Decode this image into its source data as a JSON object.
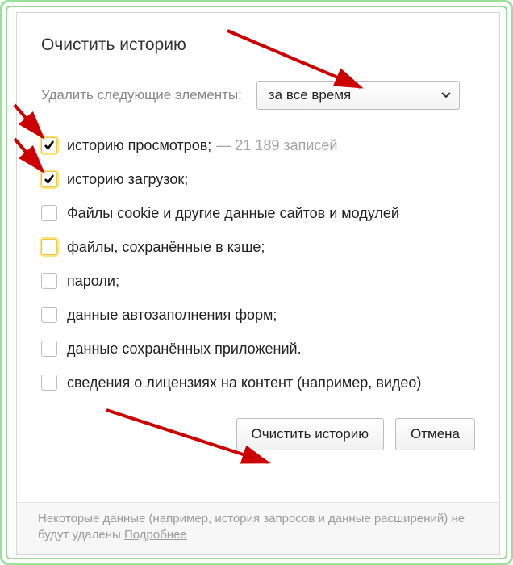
{
  "dialog": {
    "title": "Очистить историю",
    "period_label": "Удалить следующие элементы:",
    "period_value": "за все время"
  },
  "options": [
    {
      "label": "историю просмотров;",
      "checked": true,
      "highlight": true,
      "count": "21 189 записей"
    },
    {
      "label": "историю загрузок;",
      "checked": true,
      "highlight": true,
      "count": null
    },
    {
      "label": "Файлы cookie и другие данные сайтов и модулей",
      "checked": false,
      "highlight": false,
      "count": null
    },
    {
      "label": "файлы, сохранённые в кэше;",
      "checked": false,
      "highlight": true,
      "count": null
    },
    {
      "label": "пароли;",
      "checked": false,
      "highlight": false,
      "count": null
    },
    {
      "label": "данные автозаполнения форм;",
      "checked": false,
      "highlight": false,
      "count": null
    },
    {
      "label": "данные сохранённых приложений.",
      "checked": false,
      "highlight": false,
      "count": null
    },
    {
      "label": "сведения о лицензиях на контент (например, видео)",
      "checked": false,
      "highlight": false,
      "count": null
    }
  ],
  "buttons": {
    "clear": "Очистить историю",
    "cancel": "Отмена"
  },
  "footer": {
    "text": "Некоторые данные (например, история запросов и данные расширений) не будут удалены ",
    "link": "Подробнее"
  }
}
